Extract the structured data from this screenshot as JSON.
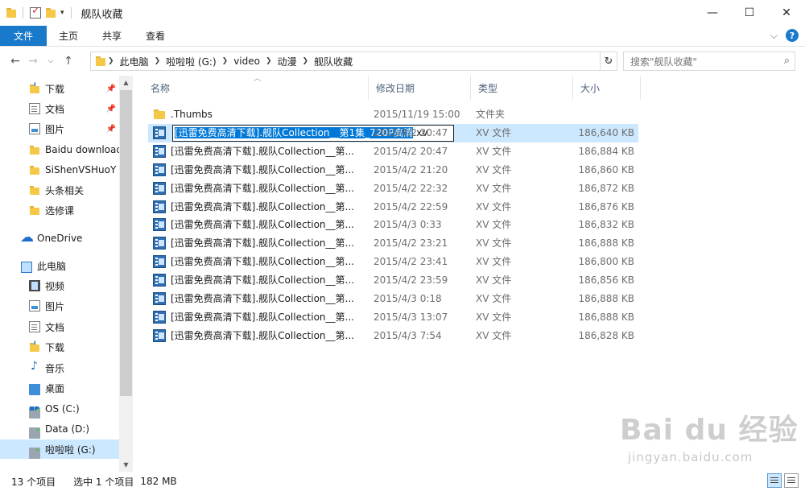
{
  "window": {
    "title": "舰队收藏"
  },
  "ribbon": {
    "tabs": [
      "文件",
      "主页",
      "共享",
      "查看"
    ]
  },
  "address": {
    "crumbs": [
      "此电脑",
      "啦啦啦 (G:)",
      "video",
      "动漫",
      "舰队收藏"
    ],
    "search_placeholder": "搜索\"舰队收藏\""
  },
  "sidebar": {
    "quick_access": [
      {
        "label": "下载",
        "icon": "download-folder-icon",
        "pinned": true
      },
      {
        "label": "文档",
        "icon": "documents-icon",
        "pinned": true
      },
      {
        "label": "图片",
        "icon": "pictures-icon",
        "pinned": true
      },
      {
        "label": "Baidu download",
        "icon": "folder-icon",
        "pinned": false
      },
      {
        "label": "SiShenVSHuoY",
        "icon": "folder-icon",
        "pinned": false
      },
      {
        "label": "头条相关",
        "icon": "folder-icon",
        "pinned": false
      },
      {
        "label": "选修课",
        "icon": "folder-icon",
        "pinned": false
      }
    ],
    "onedrive": "OneDrive",
    "this_pc": "此电脑",
    "pc_items": [
      {
        "label": "视频",
        "icon": "videos-icon"
      },
      {
        "label": "图片",
        "icon": "pictures-icon"
      },
      {
        "label": "文档",
        "icon": "documents-icon"
      },
      {
        "label": "下载",
        "icon": "download-folder-icon"
      },
      {
        "label": "音乐",
        "icon": "music-icon"
      },
      {
        "label": "桌面",
        "icon": "desktop-icon"
      },
      {
        "label": "OS (C:)",
        "icon": "os-drive-icon"
      },
      {
        "label": "Data (D:)",
        "icon": "drive-icon"
      },
      {
        "label": "啦啦啦 (G:)",
        "icon": "drive-icon",
        "selected": true
      }
    ]
  },
  "columns": {
    "name": "名称",
    "date": "修改日期",
    "type": "类型",
    "size": "大小"
  },
  "rename": {
    "selected_text": "[迅雷免费高清下载].舰队Collection__第1集_720P高清",
    "extension": ".xv"
  },
  "files": [
    {
      "name": ".Thumbs",
      "date": "2015/11/19 15:00",
      "type": "文件夹",
      "size": "",
      "icon": "folder"
    },
    {
      "name": "",
      "date": "2015/4/2 20:47",
      "type": "XV 文件",
      "size": "186,640 KB",
      "icon": "video",
      "renaming": true
    },
    {
      "name": "[迅雷免费高清下载].舰队Collection__第...",
      "date": "2015/4/2 20:47",
      "type": "XV 文件",
      "size": "186,884 KB",
      "icon": "video"
    },
    {
      "name": "[迅雷免费高清下载].舰队Collection__第...",
      "date": "2015/4/2 21:20",
      "type": "XV 文件",
      "size": "186,860 KB",
      "icon": "video"
    },
    {
      "name": "[迅雷免费高清下载].舰队Collection__第...",
      "date": "2015/4/2 22:32",
      "type": "XV 文件",
      "size": "186,872 KB",
      "icon": "video"
    },
    {
      "name": "[迅雷免费高清下载].舰队Collection__第...",
      "date": "2015/4/2 22:59",
      "type": "XV 文件",
      "size": "186,876 KB",
      "icon": "video"
    },
    {
      "name": "[迅雷免费高清下载].舰队Collection__第...",
      "date": "2015/4/3 0:33",
      "type": "XV 文件",
      "size": "186,832 KB",
      "icon": "video"
    },
    {
      "name": "[迅雷免费高清下载].舰队Collection__第...",
      "date": "2015/4/2 23:21",
      "type": "XV 文件",
      "size": "186,888 KB",
      "icon": "video"
    },
    {
      "name": "[迅雷免费高清下载].舰队Collection__第...",
      "date": "2015/4/2 23:41",
      "type": "XV 文件",
      "size": "186,800 KB",
      "icon": "video"
    },
    {
      "name": "[迅雷免费高清下载].舰队Collection__第...",
      "date": "2015/4/2 23:59",
      "type": "XV 文件",
      "size": "186,856 KB",
      "icon": "video"
    },
    {
      "name": "[迅雷免费高清下载].舰队Collection__第...",
      "date": "2015/4/3 0:18",
      "type": "XV 文件",
      "size": "186,888 KB",
      "icon": "video"
    },
    {
      "name": "[迅雷免费高清下载].舰队Collection__第...",
      "date": "2015/4/3 13:07",
      "type": "XV 文件",
      "size": "186,888 KB",
      "icon": "video"
    },
    {
      "name": "[迅雷免费高清下载].舰队Collection__第...",
      "date": "2015/4/3 7:54",
      "type": "XV 文件",
      "size": "186,828 KB",
      "icon": "video"
    }
  ],
  "status": {
    "count": "13 个项目",
    "selected": "选中 1 个项目",
    "size": "182 MB"
  },
  "watermark": {
    "logo": "Bai du 经验",
    "url": "jingyan.baidu.com"
  },
  "colors": {
    "accent": "#1979ca",
    "selection": "#cce8ff",
    "highlight": "#0078d7"
  }
}
